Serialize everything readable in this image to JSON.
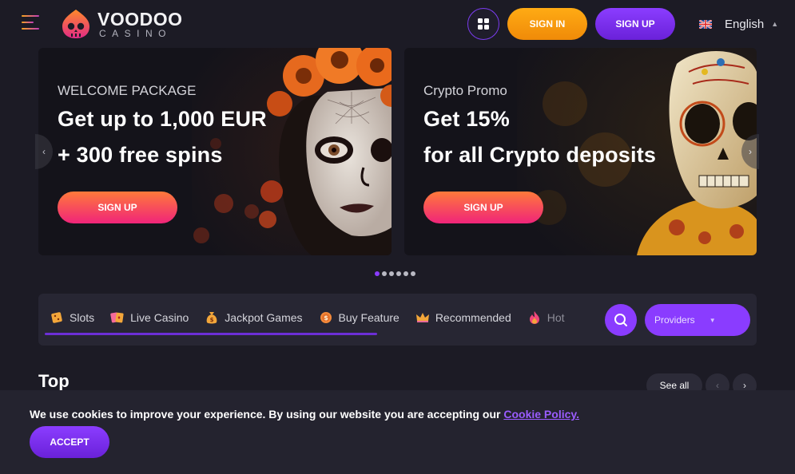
{
  "header": {
    "logo_word1": "VOODOO",
    "logo_word2": "CASINO",
    "signin_label": "SIGN IN",
    "signup_label": "SIGN UP",
    "language_label": "English",
    "menu_icon": "hamburger-icon",
    "apps_icon": "grid-icon",
    "flag_icon": "uk-flag-icon"
  },
  "banners": [
    {
      "eyebrow": "WELCOME PACKAGE",
      "headline1": "Get up to 1,000 EUR",
      "headline2": "+ 300 free spins",
      "cta": "SIGN UP"
    },
    {
      "eyebrow": "Crypto Promo",
      "headline1": "Get 15%",
      "headline2": "for all Crypto deposits",
      "cta": "SIGN UP"
    }
  ],
  "carousel": {
    "slide_count": 6,
    "active_index": 0
  },
  "categories": {
    "items": [
      {
        "label": "Slots",
        "icon": "dice-icon"
      },
      {
        "label": "Live Casino",
        "icon": "cards-icon"
      },
      {
        "label": "Jackpot Games",
        "icon": "money-bag-icon"
      },
      {
        "label": "Buy Feature",
        "icon": "coin-icon"
      },
      {
        "label": "Recommended",
        "icon": "crown-icon"
      },
      {
        "label": "Hot",
        "icon": "flame-icon"
      }
    ],
    "providers_label": "Providers"
  },
  "top_section": {
    "title": "Top",
    "see_all_label": "See all"
  },
  "cookie": {
    "text": "We use cookies to improve your experience. By using our website you are accepting our ",
    "link_label": "Cookie Policy.",
    "accept_label": "ACCEPT"
  },
  "colors": {
    "background": "#1c1b25",
    "accent_purple": "#8a3cff",
    "signin_orange": "#f59b10",
    "cta_gradient_start": "#ff7a3a",
    "cta_gradient_end": "#f0247a"
  }
}
